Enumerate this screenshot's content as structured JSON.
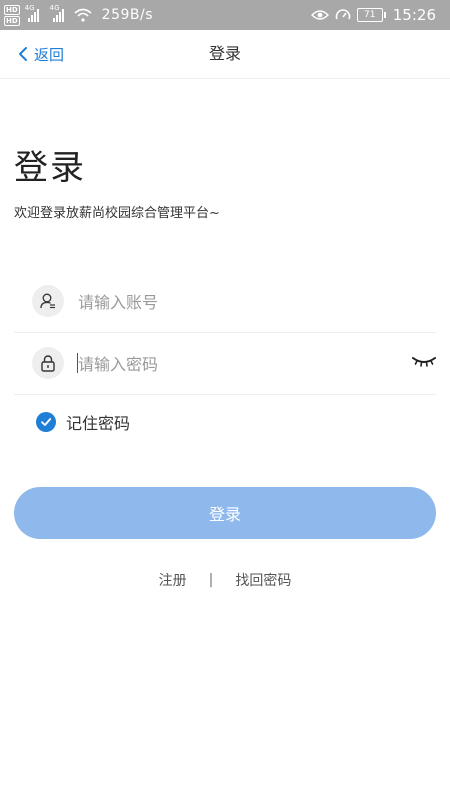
{
  "status_bar": {
    "hd1": "HD",
    "hd2": "HD",
    "net1": "4G",
    "net2": "4G",
    "speed": "259B/s",
    "battery": "71",
    "time": "15:26"
  },
  "nav": {
    "back_label": "返回",
    "title": "登录"
  },
  "header": {
    "title": "登录",
    "subtitle": "欢迎登录放薪尚校园综合管理平台~"
  },
  "form": {
    "account_placeholder": "请输入账号",
    "account_value": "",
    "password_placeholder": "请输入密码",
    "password_value": "",
    "remember_label": "记住密码",
    "remember_checked": true,
    "submit_label": "登录"
  },
  "links": {
    "register": "注册",
    "separator": "|",
    "recover": "找回密码"
  },
  "colors": {
    "accent": "#1f7ed6",
    "button_disabled": "#8fb9ec",
    "status_bar": "#a8a8a8"
  },
  "icons": {
    "back": "chevron-left-icon",
    "account": "user-icon",
    "password": "lock-icon",
    "visibility": "eye-closed-icon",
    "remember": "check-icon"
  }
}
